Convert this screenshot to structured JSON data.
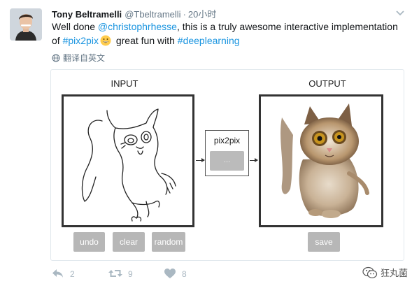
{
  "tweet": {
    "author": {
      "display_name": "Tony Beltramelli",
      "handle": "@Tbeltramelli",
      "separator": "·",
      "time": "20小时"
    },
    "text": {
      "t1": "Well done ",
      "mention": "@christophrhesse",
      "t2": ", this is a truly awesome interactive implementation of ",
      "hashtag1": "#pix2pix",
      "t3": " great fun with ",
      "hashtag2": "#deeplearning"
    },
    "translate_label": "翻译自英文"
  },
  "card": {
    "input_title": "INPUT",
    "output_title": "OUTPUT",
    "model_label": "pix2pix",
    "process_button": "...",
    "undo_label": "undo",
    "clear_label": "clear",
    "random_label": "random",
    "save_label": "save"
  },
  "actions": {
    "reply_count": "2",
    "retweet_count": "9",
    "like_count": "8"
  },
  "watermark": {
    "text": "狂丸菌"
  },
  "icons": {
    "avatar": "avatar",
    "chevron": "chevron-down-icon",
    "globe": "globe-icon",
    "emoji": "grinning-emoji-icon",
    "reply": "reply-icon",
    "retweet": "retweet-icon",
    "like": "heart-icon",
    "wechat": "wechat-icon"
  },
  "colors": {
    "link": "#1b95e0",
    "muted": "#657786",
    "action_icons": "#aab8c2",
    "button_gray": "#b7b7b7"
  }
}
